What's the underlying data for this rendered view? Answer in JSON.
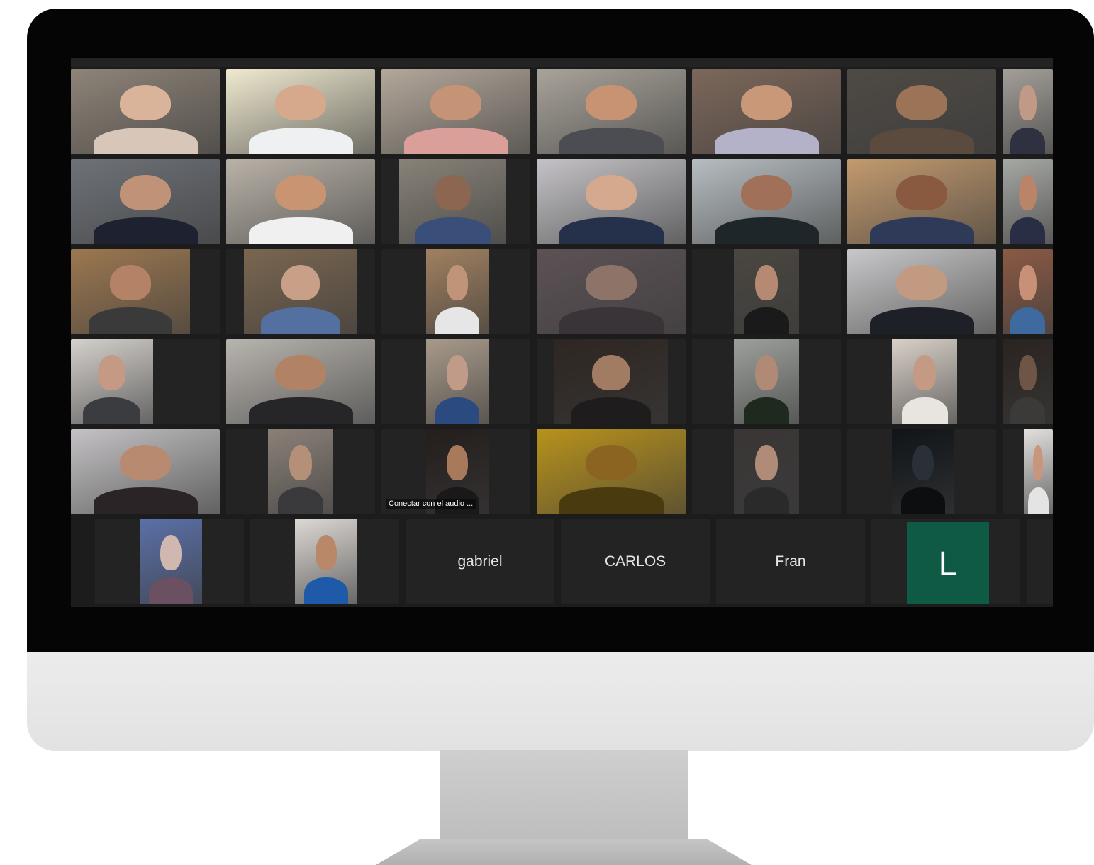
{
  "colors": {
    "screen_bg": "#1c1c1c",
    "tile_bg": "#232323",
    "active_speaker": "#34c24a",
    "avatar_green": "#0f5a45"
  },
  "participants": [
    {
      "kind": "video",
      "bg": "#8e8478",
      "skin": "#d9b39a",
      "shirt": "#d8c6b8",
      "active": true
    },
    {
      "kind": "video",
      "bg": "#efe9cf",
      "skin": "#d6a88c",
      "shirt": "#eef0f2"
    },
    {
      "kind": "video",
      "bg": "#b3a79a",
      "skin": "#c59376",
      "shirt": "#d99f98"
    },
    {
      "kind": "video",
      "bg": "#a8a39a",
      "skin": "#c79373",
      "shirt": "#4b4d52"
    },
    {
      "kind": "video",
      "bg": "#7c675a",
      "skin": "#c89878",
      "shirt": "#b4b2c8"
    },
    {
      "kind": "video",
      "bg": "#4e4a45",
      "skin": "#9b7356",
      "shirt": "#5b4b3e"
    },
    {
      "kind": "video",
      "bg": "#a39e98",
      "skin": "#c09a86",
      "shirt": "#2f3140"
    },
    {
      "kind": "video",
      "bg": "#6e7278",
      "skin": "#c09277",
      "shirt": "#1e2230"
    },
    {
      "kind": "video",
      "bg": "#b9b2a8",
      "skin": "#c99471",
      "shirt": "#f0f0f0"
    },
    {
      "kind": "video",
      "bg": "#888278",
      "skin": "#8c6650",
      "shirt": "#3a4e7a",
      "inset": [
        0.12,
        0.84
      ]
    },
    {
      "kind": "video",
      "bg": "#c4c2c6",
      "skin": "#d4a98e",
      "shirt": "#25304a"
    },
    {
      "kind": "video",
      "bg": "#b6bdc0",
      "skin": "#a07058",
      "shirt": "#1f262a"
    },
    {
      "kind": "video",
      "bg": "#c29a6e",
      "skin": "#8a5a40",
      "shirt": "#2e3a58"
    },
    {
      "kind": "video",
      "bg": "#a6a8a4",
      "skin": "#b98468",
      "shirt": "#2a2e44"
    },
    {
      "kind": "video",
      "bg": "#9c7850",
      "skin": "#b48266",
      "shirt": "#3a3a3a",
      "inset": [
        0.0,
        0.8
      ]
    },
    {
      "kind": "video",
      "bg": "#7a6650",
      "skin": "#c8a088",
      "shirt": "#5470a0",
      "inset": [
        0.12,
        0.88
      ]
    },
    {
      "kind": "video",
      "bg": "#a08060",
      "skin": "#c09478",
      "shirt": "#e6e6e6",
      "inset": [
        0.3,
        0.72
      ]
    },
    {
      "kind": "video",
      "bg": "#5c5256",
      "skin": "#8e7468",
      "shirt": "#3a3438"
    },
    {
      "kind": "video",
      "bg": "#4a4640",
      "skin": "#b68a72",
      "shirt": "#1a1a1a",
      "inset": [
        0.28,
        0.72
      ]
    },
    {
      "kind": "video",
      "bg": "#c8c8ca",
      "skin": "#c29a82",
      "shirt": "#1e2028"
    },
    {
      "kind": "video",
      "bg": "#8a5a44",
      "skin": "#c99078",
      "shirt": "#3e6aa0"
    },
    {
      "kind": "video",
      "bg": "#d4d0cc",
      "skin": "#c49a84",
      "shirt": "#3a3c40",
      "inset": [
        0.0,
        0.55
      ]
    },
    {
      "kind": "video",
      "bg": "#b8b4ae",
      "skin": "#b28264",
      "shirt": "#262628"
    },
    {
      "kind": "video",
      "bg": "#a89a8a",
      "skin": "#c09c88",
      "shirt": "#2a4a80",
      "inset": [
        0.3,
        0.72
      ]
    },
    {
      "kind": "video",
      "bg": "#2e2622",
      "skin": "#a27c62",
      "shirt": "#1e1c1c",
      "inset": [
        0.12,
        0.88
      ]
    },
    {
      "kind": "video",
      "bg": "#9ca09c",
      "skin": "#b08a74",
      "shirt": "#1e2a1e",
      "inset": [
        0.28,
        0.72
      ]
    },
    {
      "kind": "video",
      "bg": "#d8d0c8",
      "skin": "#c49a84",
      "shirt": "#e8e4e0",
      "inset": [
        0.3,
        0.74
      ]
    },
    {
      "kind": "video",
      "bg": "#2a2420",
      "skin": "#6e5646",
      "shirt": "#3c3a38"
    },
    {
      "kind": "video",
      "bg": "#c4c2c4",
      "skin": "#b88a70",
      "shirt": "#2a2426"
    },
    {
      "kind": "video",
      "bg": "#8a8078",
      "skin": "#b49078",
      "shirt": "#3a3a3c",
      "inset": [
        0.28,
        0.72
      ]
    },
    {
      "kind": "video",
      "bg": "#241e1c",
      "skin": "#a87a5c",
      "shirt": "#1a1818",
      "inset": [
        0.3,
        0.72
      ],
      "overlay": "Conectar con el audio  ..."
    },
    {
      "kind": "video",
      "bg": "#b8921c",
      "skin": "#8a6420",
      "shirt": "#4a3a10"
    },
    {
      "kind": "video",
      "bg": "#3a3636",
      "skin": "#b08c78",
      "shirt": "#2a2a2a",
      "inset": [
        0.28,
        0.72
      ]
    },
    {
      "kind": "video",
      "bg": "#101418",
      "skin": "#2a3038",
      "shirt": "#0c0e10",
      "inset": [
        0.3,
        0.72
      ]
    },
    {
      "kind": "video",
      "bg": "#e2e0de",
      "skin": "#c8967c",
      "shirt": "#e4e4e4",
      "inset": [
        0.42,
        1.0
      ]
    },
    {
      "kind": "video",
      "bg": "#5a70a8",
      "skin": "#d0b8b0",
      "shirt": "#6a5060",
      "inset": [
        0.3,
        0.72
      ]
    },
    {
      "kind": "video",
      "bg": "#dcd8d4",
      "skin": "#b88868",
      "shirt": "#1e5aa8",
      "inset": [
        0.3,
        0.72
      ]
    },
    {
      "kind": "name",
      "label": "gabriel"
    },
    {
      "kind": "name",
      "label": "CARLOS"
    },
    {
      "kind": "name",
      "label": "Fran"
    },
    {
      "kind": "avatar",
      "label": "L"
    },
    {
      "kind": "empty"
    }
  ]
}
